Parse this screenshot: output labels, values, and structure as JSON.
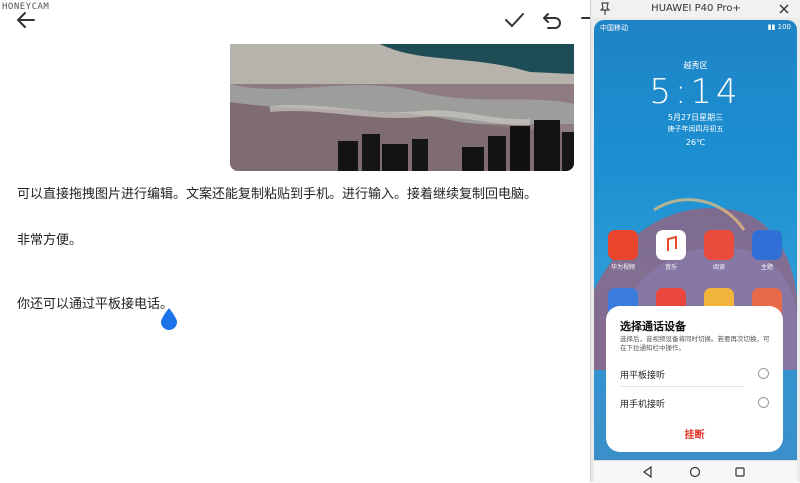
{
  "watermark": "HONEYCAM",
  "toolbar": {
    "back_icon": "arrow-left-icon",
    "confirm_icon": "check-icon",
    "undo_icon": "undo-icon",
    "redo_icon": "redo-icon"
  },
  "note": {
    "image": "city-skyline-photo",
    "lines": [
      "可以直接拖拽图片进行编辑。文案还能复制粘贴到手机。进行输入。接着继续复制回电脑。",
      "非常方便。",
      "你还可以通过平板接电话。"
    ],
    "cursor_color": "#1a73e8"
  },
  "phone": {
    "window_title": "HUAWEI P40 Pro+",
    "status_left": "中国移动",
    "status_right": "▮▮ 100",
    "lockscreen": {
      "location": "越秀区",
      "time": "5:14",
      "date": "5月27日星期三",
      "lunar": "庚子年闰四月初五",
      "weather": "26℃"
    },
    "apps_row1": [
      {
        "name": "华为视频",
        "color": "#e8452c"
      },
      {
        "name": "音乐",
        "color": "#ffffff"
      },
      {
        "name": "阅读",
        "color": "#e94b3c"
      },
      {
        "name": "主题",
        "color": "#2f6fd6"
      }
    ],
    "call_sheet": {
      "title": "选择通话设备",
      "description": "选择后，音视频设备将同时切换。若要再次切换，可在下拉通知栏中操作。",
      "option_tablet": "用平板接听",
      "option_phone": "用手机接听",
      "hangup": "挂断",
      "accent": "#e2362b"
    }
  }
}
